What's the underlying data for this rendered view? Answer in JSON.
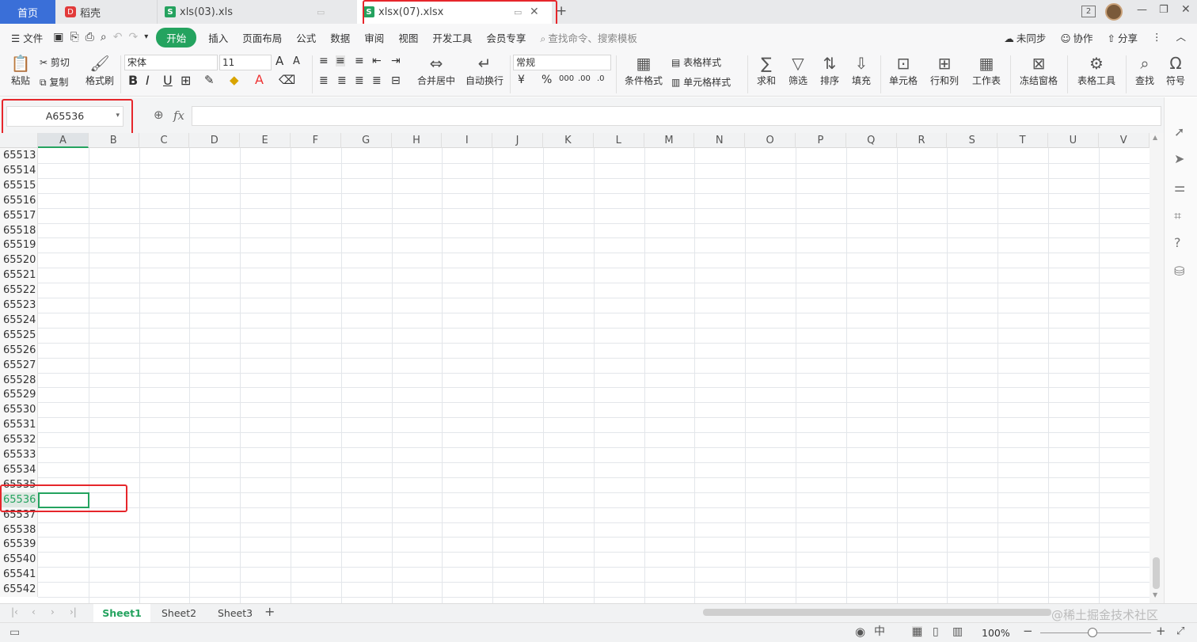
{
  "tabs": {
    "home": "首页",
    "daoke": "稻壳",
    "xls": "xls(03).xls",
    "xlsx": "xlsx(07).xlsx",
    "new_tab": "+"
  },
  "window": {
    "badge": "2"
  },
  "menu": {
    "file": "文件",
    "start": "开始",
    "insert": "插入",
    "layout": "页面布局",
    "formula": "公式",
    "data": "数据",
    "review": "审阅",
    "view": "视图",
    "dev": "开发工具",
    "member": "会员专享",
    "search_placeholder": "查找命令、搜索模板",
    "unsynced": "未同步",
    "collab": "协作",
    "share": "分享"
  },
  "ribbon": {
    "paste": "粘贴",
    "cut": "剪切",
    "copy": "复制",
    "format_painter": "格式刷",
    "font": "宋体",
    "font_size": "11",
    "merge_center": "合并居中",
    "wrap": "自动换行",
    "number_format": "常规",
    "cond_format": "条件格式",
    "table_style": "表格样式",
    "cell_style": "单元格样式",
    "sum": "求和",
    "filter": "筛选",
    "sort": "排序",
    "fill": "填充",
    "cell": "单元格",
    "row_col": "行和列",
    "worksheet": "工作表",
    "freeze": "冻结窗格",
    "table_tools": "表格工具",
    "find": "查找",
    "symbol": "符号"
  },
  "formula_bar": {
    "name_box": "A65536",
    "fx": "fx",
    "content": ""
  },
  "grid": {
    "columns": [
      "A",
      "B",
      "C",
      "D",
      "E",
      "F",
      "G",
      "H",
      "I",
      "J",
      "K",
      "L",
      "M",
      "N",
      "O",
      "P",
      "Q",
      "R",
      "S",
      "T",
      "U",
      "V"
    ],
    "rows": [
      "65513",
      "65514",
      "65515",
      "65516",
      "65517",
      "65518",
      "65519",
      "65520",
      "65521",
      "65522",
      "65523",
      "65524",
      "65525",
      "65526",
      "65527",
      "65528",
      "65529",
      "65530",
      "65531",
      "65532",
      "65533",
      "65534",
      "65535",
      "65536",
      "65537",
      "65538",
      "65539",
      "65540",
      "65541",
      "65542"
    ],
    "selected_row": "65536",
    "selected_col": "A"
  },
  "sheets": [
    "Sheet1",
    "Sheet2",
    "Sheet3"
  ],
  "status": {
    "zoom": "100%"
  },
  "watermark": "@稀土掘金技术社区",
  "colors": {
    "accent": "#24a35f",
    "highlight": "#e6262b",
    "home_tab": "#3a6fd8"
  }
}
